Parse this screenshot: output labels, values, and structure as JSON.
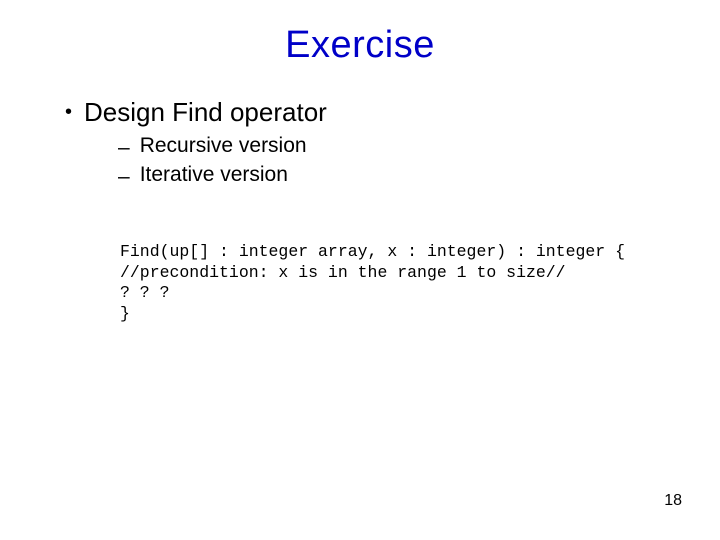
{
  "title": "Exercise",
  "bullets": {
    "l1": "Design Find operator",
    "l2a": "Recursive version",
    "l2b": "Iterative version"
  },
  "code": {
    "line1": "Find(up[] : integer array, x : integer) : integer {",
    "line2": "//precondition: x is in the range 1 to size//",
    "line3": "? ? ?",
    "line4": "}"
  },
  "page_number": "18"
}
